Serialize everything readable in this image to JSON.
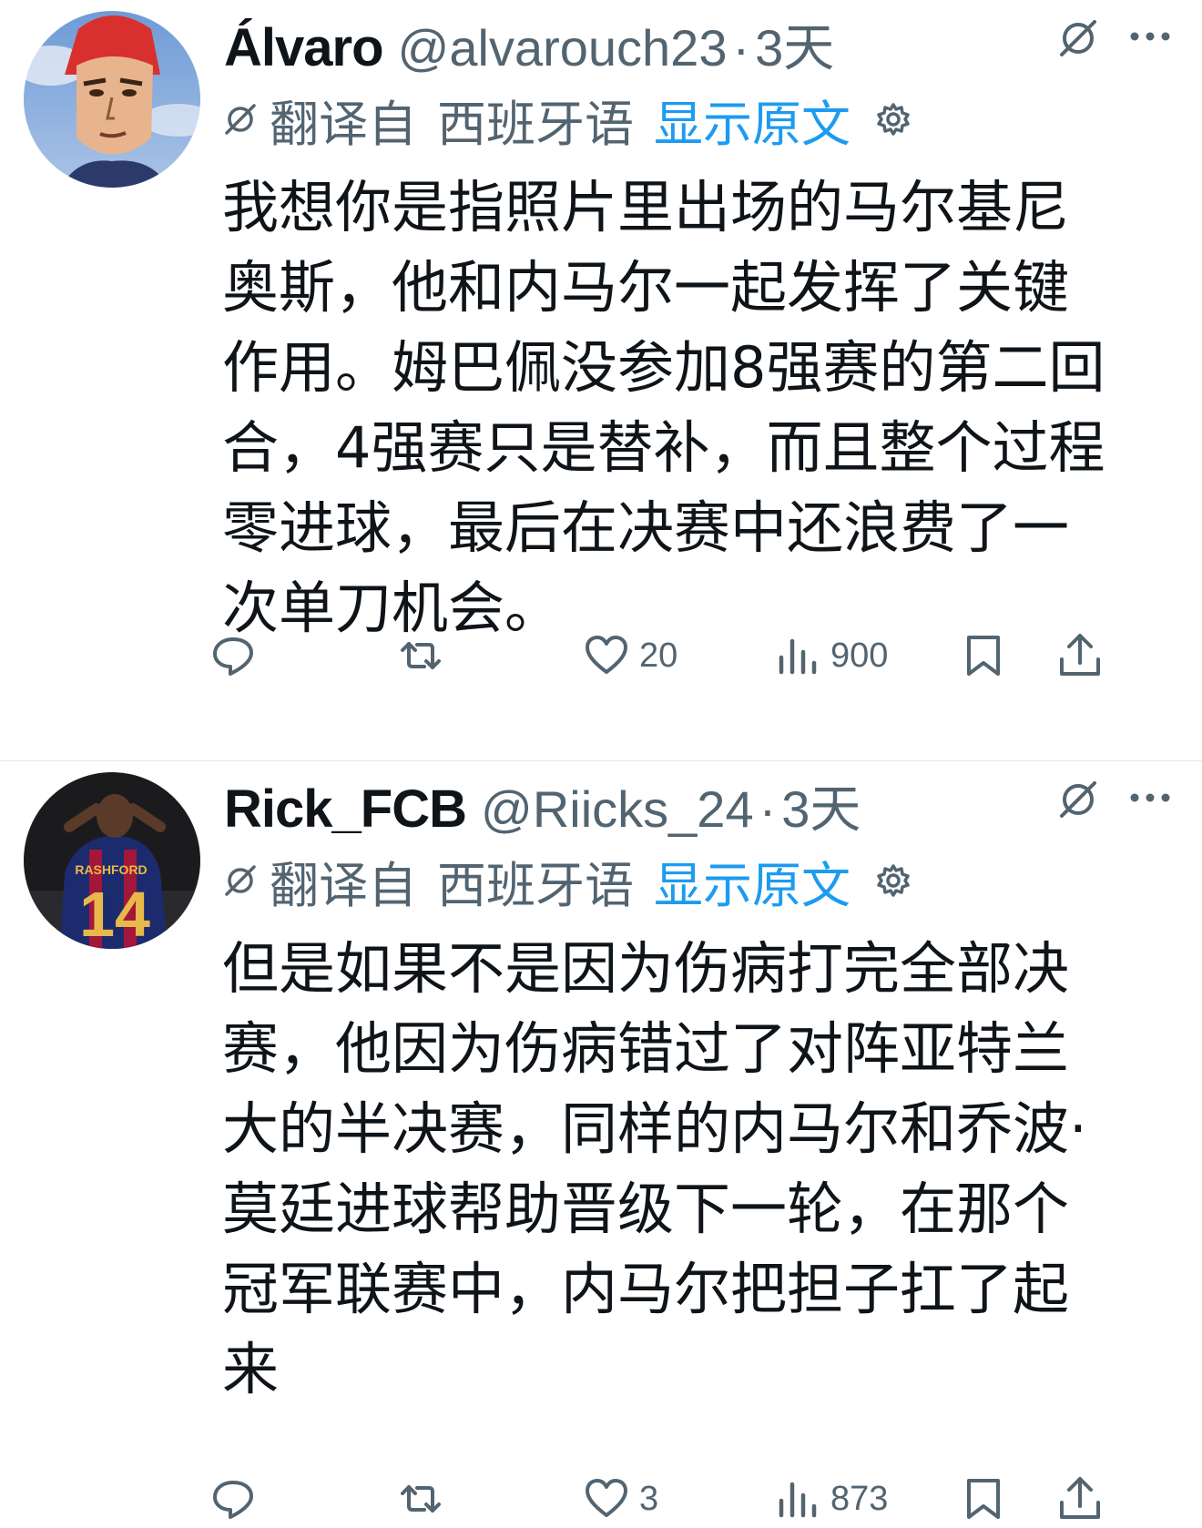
{
  "tweets": [
    {
      "name": "Álvaro",
      "handle": "@alvarouch23",
      "separator": "·",
      "time": "3天",
      "translation": {
        "prefix": "翻译自",
        "language": "西班牙语",
        "show_original": "显示原文"
      },
      "text": "我想你是指照片里出场的马尔基尼\n奥斯，他和内马尔一起发挥了关键\n作用。姆巴佩没参加8强赛的第二回\n合，4强赛只是替补，而且整个过程\n零进球，最后在决赛中还浪费了一\n次单刀机会。",
      "stats": {
        "replies": "",
        "retweets": "",
        "likes": "20",
        "views": "900"
      }
    },
    {
      "name": "Rick_FCB",
      "handle": "@Riicks_24",
      "separator": "·",
      "time": "3天",
      "translation": {
        "prefix": "翻译自",
        "language": "西班牙语",
        "show_original": "显示原文"
      },
      "text": "但是如果不是因为伤病打完全部决\n赛，他因为伤病错过了对阵亚特兰\n大的半决赛，同样的内马尔和乔波·\n莫廷进球帮助晋级下一轮，在那个\n冠军联赛中，内马尔把担子扛了起\n来",
      "stats": {
        "replies": "",
        "retweets": "",
        "likes": "3",
        "views": "873"
      }
    }
  ],
  "icons": {
    "grok": "grok-icon",
    "more": "more-dots-icon",
    "translate": "translate-slash-icon",
    "settings": "gear-icon",
    "reply": "reply-bubble-icon",
    "retweet": "retweet-icon",
    "like": "heart-icon",
    "views": "views-bars-icon",
    "bookmark": "bookmark-icon",
    "share": "share-upload-icon"
  },
  "colors": {
    "text": "#0f1419",
    "secondary": "#536471",
    "link": "#1d9bf0",
    "divider": "#e6e8ea"
  }
}
